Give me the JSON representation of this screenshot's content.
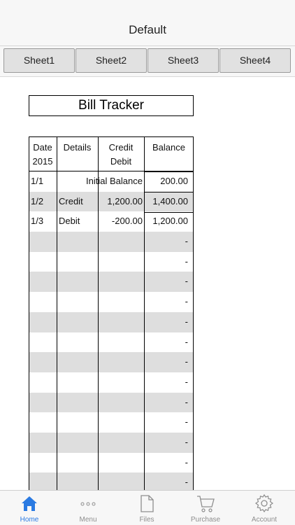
{
  "header": {
    "title": "Default"
  },
  "sheet_tabs": [
    {
      "label": "Sheet1"
    },
    {
      "label": "Sheet2"
    },
    {
      "label": "Sheet3"
    },
    {
      "label": "Sheet4"
    }
  ],
  "sheet": {
    "title": "Bill Tracker",
    "columns": [
      {
        "line1": "Date",
        "line2": "2015"
      },
      {
        "line1": "Details",
        "line2": ""
      },
      {
        "line1": "Credit",
        "line2": "Debit"
      },
      {
        "line1": "Balance",
        "line2": ""
      }
    ],
    "initial_row": {
      "date": "1/1",
      "label": "Initial Balance",
      "balance": "200.00"
    },
    "rows": [
      {
        "date": "1/2",
        "details": "Credit",
        "amount": "1,200.00",
        "balance": "1,400.00"
      },
      {
        "date": "1/3",
        "details": "Debit",
        "amount": "-200.00",
        "balance": "1,200.00"
      },
      {
        "date": "",
        "details": "",
        "amount": "",
        "balance": "-"
      },
      {
        "date": "",
        "details": "",
        "amount": "",
        "balance": "-"
      },
      {
        "date": "",
        "details": "",
        "amount": "",
        "balance": "-"
      },
      {
        "date": "",
        "details": "",
        "amount": "",
        "balance": "-"
      },
      {
        "date": "",
        "details": "",
        "amount": "",
        "balance": "-"
      },
      {
        "date": "",
        "details": "",
        "amount": "",
        "balance": "-"
      },
      {
        "date": "",
        "details": "",
        "amount": "",
        "balance": "-"
      },
      {
        "date": "",
        "details": "",
        "amount": "",
        "balance": "-"
      },
      {
        "date": "",
        "details": "",
        "amount": "",
        "balance": "-"
      },
      {
        "date": "",
        "details": "",
        "amount": "",
        "balance": "-"
      },
      {
        "date": "",
        "details": "",
        "amount": "",
        "balance": "-"
      },
      {
        "date": "",
        "details": "",
        "amount": "",
        "balance": "-"
      },
      {
        "date": "",
        "details": "",
        "amount": "",
        "balance": "-"
      }
    ]
  },
  "tab_bar": {
    "accent_color": "#2a7ae2",
    "items": [
      {
        "label": "Home",
        "icon": "home-icon",
        "active": true
      },
      {
        "label": "Menu",
        "icon": "ellipsis-icon",
        "active": false
      },
      {
        "label": "Files",
        "icon": "file-icon",
        "active": false
      },
      {
        "label": "Purchase",
        "icon": "cart-icon",
        "active": false
      },
      {
        "label": "Account",
        "icon": "gear-icon",
        "active": false
      }
    ]
  }
}
